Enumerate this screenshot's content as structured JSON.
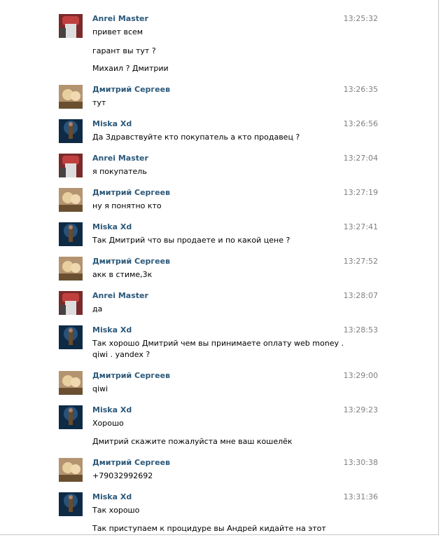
{
  "messages": [
    {
      "author": "Anrei Master",
      "avatar": "avatar-anrei",
      "time": "13:25:32",
      "lines": [
        "привет всем",
        "гарант вы тут ?",
        "Михаил ? Дмитрии"
      ]
    },
    {
      "author": "Дмитрий Сергеев",
      "avatar": "avatar-dmitry",
      "time": "13:26:35",
      "lines": [
        "тут"
      ]
    },
    {
      "author": "Miska Xd",
      "avatar": "avatar-miska",
      "time": "13:26:56",
      "lines": [
        "Да Здравствуйте кто покупатель а кто продавец ?"
      ]
    },
    {
      "author": "Anrei Master",
      "avatar": "avatar-anrei",
      "time": "13:27:04",
      "lines": [
        "я покупатель"
      ]
    },
    {
      "author": "Дмитрий Сергеев",
      "avatar": "avatar-dmitry",
      "time": "13:27:19",
      "lines": [
        "ну я понятно кто"
      ]
    },
    {
      "author": "Miska Xd",
      "avatar": "avatar-miska",
      "time": "13:27:41",
      "lines": [
        "Так Дмитрий что вы продаете и по какой цене ?"
      ]
    },
    {
      "author": "Дмитрий Сергеев",
      "avatar": "avatar-dmitry",
      "time": "13:27:52",
      "lines": [
        "акк в стиме,3к"
      ]
    },
    {
      "author": "Anrei Master",
      "avatar": "avatar-anrei",
      "time": "13:28:07",
      "lines": [
        "да"
      ]
    },
    {
      "author": "Miska Xd",
      "avatar": "avatar-miska",
      "time": "13:28:53",
      "lines": [
        "Так хорошо Дмитрий чем вы принимаете оплату web money . qiwi . yandex ?"
      ]
    },
    {
      "author": "Дмитрий Сергеев",
      "avatar": "avatar-dmitry",
      "time": "13:29:00",
      "lines": [
        "qiwi"
      ]
    },
    {
      "author": "Miska Xd",
      "avatar": "avatar-miska",
      "time": "13:29:23",
      "lines": [
        "Хорошо",
        "Дмитрий скажите пожалуйста мне ваш кошелёк"
      ]
    },
    {
      "author": "Дмитрий Сергеев",
      "avatar": "avatar-dmitry",
      "time": "13:30:38",
      "lines": [
        "+79032992692"
      ]
    },
    {
      "author": "Miska Xd",
      "avatar": "avatar-miska",
      "time": "13:31:36",
      "lines": [
        "Так хорошо",
        "Так приступаем к процидуре вы Андрей кидайте на этот кошелек"
      ]
    }
  ],
  "colors": {
    "author": "#2b587a",
    "time": "#808080",
    "text": "#000000"
  }
}
